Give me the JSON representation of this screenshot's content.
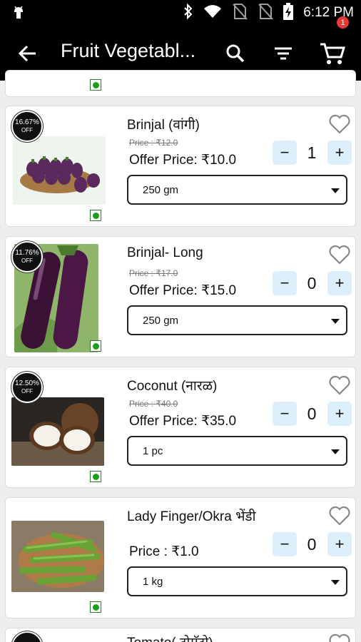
{
  "status_bar": {
    "time": "6:12 PM"
  },
  "app_bar": {
    "title": "Fruit Vegetabl...",
    "cart_count": "1"
  },
  "products": [
    {
      "discount": "16.67%",
      "off_label": "OFF",
      "name": "Brinjal (वांगी)",
      "price": "Price : ₹12.0",
      "offer_price": "Offer Price: ₹10.0",
      "quantity": "1",
      "unit": "250 gm",
      "image": "purple round brinjals in basket"
    },
    {
      "discount": "11.76%",
      "off_label": "OFF",
      "name": "Brinjal- Long",
      "price": "Price : ₹17.0",
      "offer_price": "Offer Price: ₹15.0",
      "quantity": "0",
      "unit": "250 gm",
      "image": "long purple brinjals"
    },
    {
      "discount": "12.50%",
      "off_label": "OFF",
      "name": "Coconut (नारळ)",
      "price": "Price : ₹40.0",
      "offer_price": "Offer Price: ₹35.0",
      "quantity": "0",
      "unit": "1 pc",
      "image": "coconut halves"
    },
    {
      "name": "Lady Finger/Okra भेंडी",
      "price": "Price : ₹1.0",
      "quantity": "0",
      "unit": "1 kg",
      "image": "okra pods in basket"
    },
    {
      "name": "Tomato( टोमॅटो)"
    }
  ],
  "icons": [
    "android-icon",
    "bluetooth-icon",
    "wifi-icon",
    "no-sim-icon",
    "battery-charging-icon",
    "back-arrow-icon",
    "search-icon",
    "filter-icon",
    "cart-icon",
    "heart-icon",
    "veg-icon",
    "dropdown-caret-icon"
  ],
  "colors": {
    "app_bar": "#000000",
    "qty_button": "#dceffb",
    "badge": "#e53935",
    "veg": "#1b9e1b"
  }
}
